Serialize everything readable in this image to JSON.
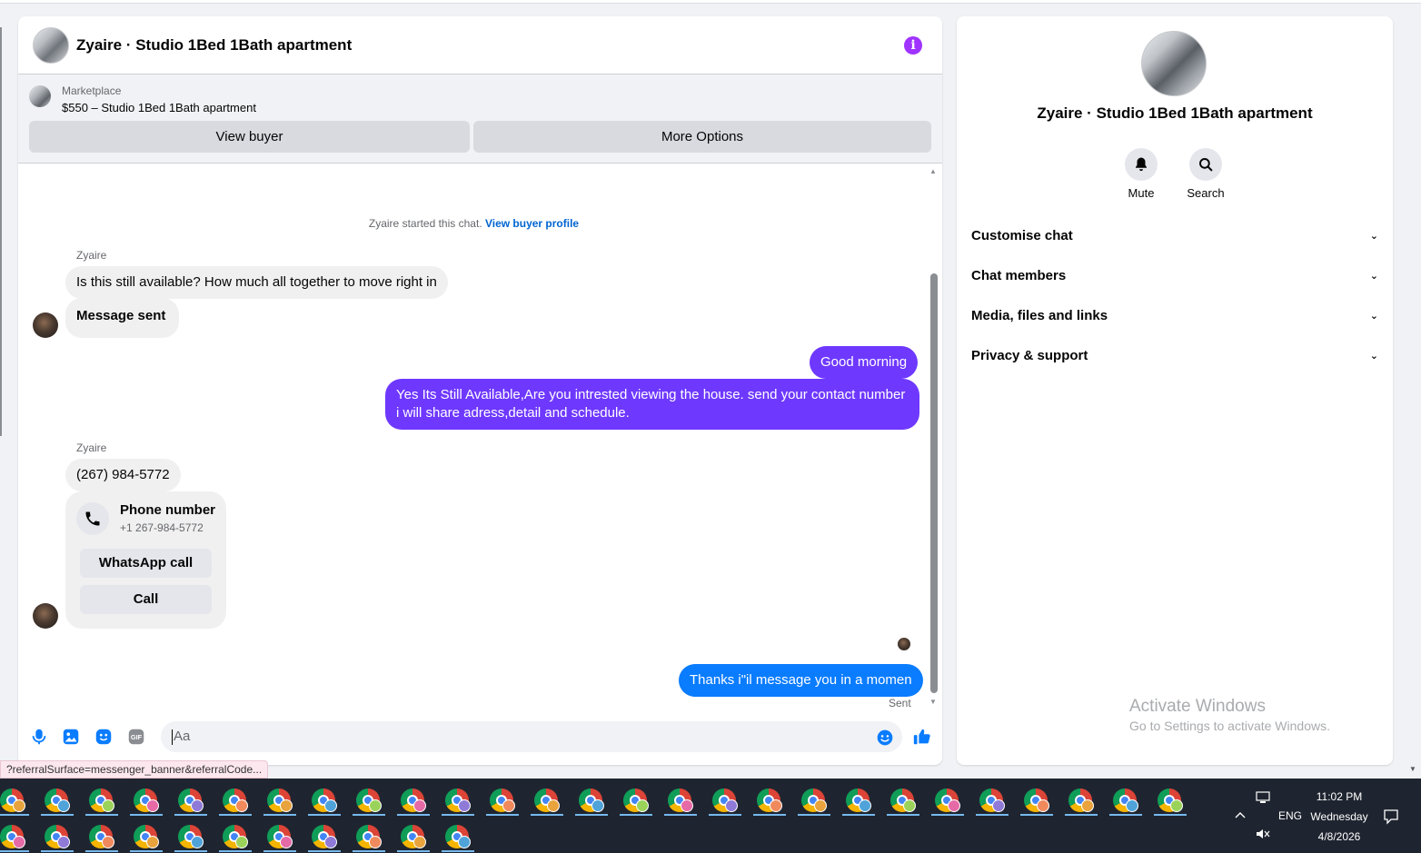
{
  "chat": {
    "title": "Zyaire · Studio 1Bed 1Bath apartment",
    "info_icon_glyph": "i"
  },
  "marketplace": {
    "label": "Marketplace",
    "item": "$550 – Studio 1Bed 1Bath apartment",
    "view_buyer": "View buyer",
    "more_options": "More Options"
  },
  "conversation": {
    "started_text": "Zyaire started this chat.",
    "started_link": "View buyer profile",
    "sender": "Zyaire",
    "msg1": "Is this still available? How much all together to move right in",
    "msg2": "Message sent",
    "out1": "Good morning",
    "out2": "Yes Its Still Available,Are you intrested viewing the house. send your contact number i will share adress,detail and schedule.",
    "sender2": "Zyaire",
    "msg3": "(267) 984-5772",
    "phone_card": {
      "title": "Phone number",
      "number": "+1 267-984-5772",
      "whatsapp": "WhatsApp call",
      "call": "Call"
    },
    "out3": "Thanks i\"il message you in a momen",
    "status": "Sent"
  },
  "composer": {
    "placeholder": "Aa",
    "icons": [
      "microphone-icon",
      "image-icon",
      "sticker-icon",
      "gif-icon",
      "emoji-icon",
      "like-icon"
    ],
    "gif_label": "GIF"
  },
  "side": {
    "title": "Zyaire · Studio 1Bed 1Bath apartment",
    "mute": "Mute",
    "search": "Search",
    "menu": [
      "Customise chat",
      "Chat members",
      "Media, files and links",
      "Privacy & support"
    ]
  },
  "watermark": {
    "line1": "Activate Windows",
    "line2": "Go to Settings to activate Windows."
  },
  "status_url": "?referralSurface=messenger_banner&referralCode...",
  "taskbar": {
    "lang": "ENG",
    "time": "11:02 PM",
    "day": "Wednesday",
    "date": "4/8/2026"
  },
  "colors": {
    "accent_purple": "#6e38ff",
    "accent_blue": "#0a7cff",
    "info_purple": "#a033ff",
    "link": "#0064d1"
  }
}
